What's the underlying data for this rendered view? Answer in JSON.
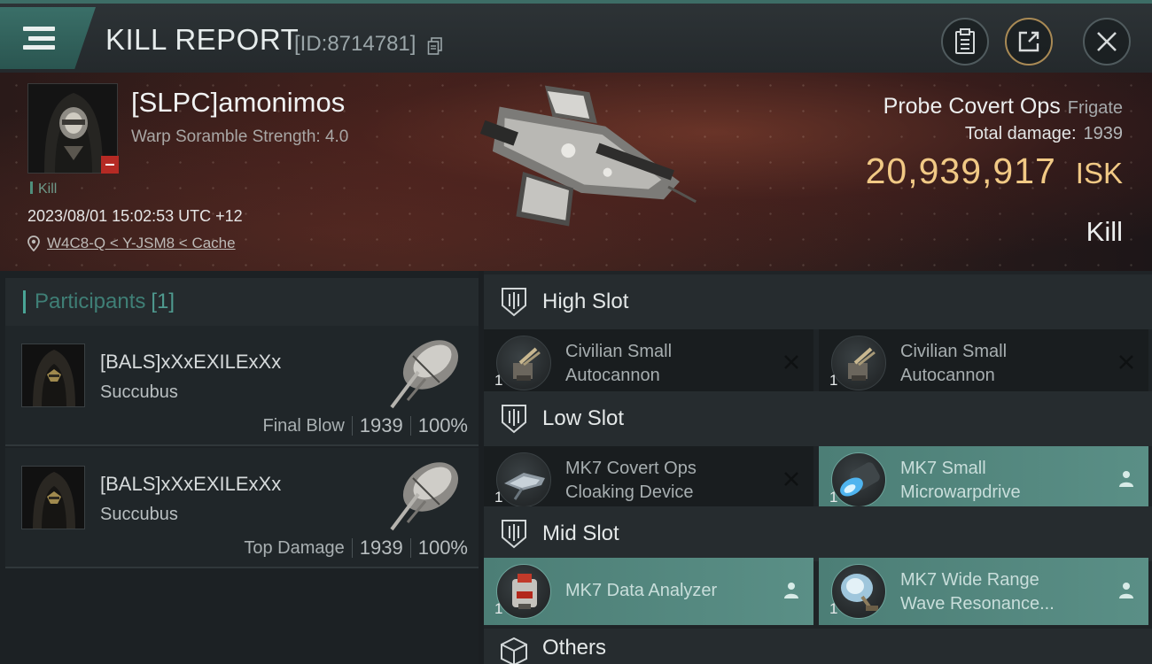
{
  "header": {
    "title": "KILL REPORT",
    "report_id": "[ID:8714781]"
  },
  "victim": {
    "name": "[SLPC]amonimos",
    "warp_scramble": "Warp Soramble Strength: 4.0",
    "tag": "Kill",
    "datetime": "2023/08/01 15:02:53 UTC +12",
    "location": "W4C8-Q < Y-JSM8 < Cache",
    "ship_name": "Probe Covert Ops",
    "ship_class": "Frigate",
    "total_damage_label": "Total damage:",
    "total_damage_value": "1939",
    "isk_value": "20,939,917",
    "isk_unit": "ISK",
    "result": "Kill"
  },
  "participants": {
    "label": "Participants",
    "count": "[1]",
    "rows": [
      {
        "name": "[BALS]xXxEXILExXx",
        "ship": "Succubus",
        "role": "Final Blow",
        "damage": "1939",
        "percent": "100%"
      },
      {
        "name": "[BALS]xXxEXILExXx",
        "ship": "Succubus",
        "role": "Top Damage",
        "damage": "1939",
        "percent": "100%"
      }
    ]
  },
  "slots": {
    "high": {
      "label": "High Slot",
      "modules": [
        {
          "name": "Civilian Small Autocannon",
          "line1": "Civilian Small",
          "line2": "Autocannon",
          "qty": "1",
          "status": "destroyed"
        },
        {
          "name": "Civilian Small Autocannon",
          "line1": "Civilian Small",
          "line2": "Autocannon",
          "qty": "1",
          "status": "destroyed"
        }
      ]
    },
    "low": {
      "label": "Low Slot",
      "modules": [
        {
          "name": "MK7 Covert Ops Cloaking Device",
          "line1": "MK7 Covert Ops",
          "line2": "Cloaking Device",
          "qty": "1",
          "status": "destroyed"
        },
        {
          "name": "MK7 Small Microwarpdrive",
          "line1": "MK7 Small",
          "line2": "Microwarpdrive",
          "qty": "1",
          "status": "dropped"
        }
      ]
    },
    "mid": {
      "label": "Mid Slot",
      "modules": [
        {
          "name": "MK7 Data Analyzer",
          "line1": "MK7 Data Analyzer",
          "line2": "",
          "qty": "1",
          "status": "dropped"
        },
        {
          "name": "MK7 Wide Range Wave Resonance...",
          "line1": "MK7 Wide Range",
          "line2": "Wave Resonance...",
          "qty": "1",
          "status": "dropped"
        }
      ]
    },
    "others": {
      "label": "Others"
    }
  },
  "colors": {
    "accent_teal": "#4aa596",
    "isk_gold": "#f1c985",
    "fitted_module": "#5a8f86",
    "victim_badge": "#b52a24"
  },
  "icons": {
    "menu": "menu-icon",
    "copy": "copy-icon",
    "clipboard": "clipboard-icon",
    "share": "share-icon",
    "close": "close-icon",
    "location": "location-pin-icon",
    "slot": "slot-shield-icon",
    "others": "cube-icon",
    "destroyed": "x-icon",
    "dropped": "person-icon"
  }
}
